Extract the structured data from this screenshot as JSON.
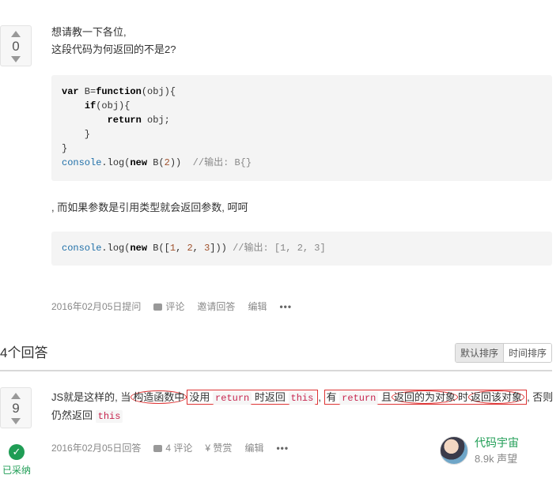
{
  "question": {
    "votes": "0",
    "lines": [
      "想请教一下各位,",
      "这段代码为何返回的不是2?"
    ],
    "code1": [
      {
        "parts": [
          [
            "kw",
            "var"
          ],
          [
            "",
            " B="
          ],
          [
            "kw",
            "function"
          ],
          [
            "",
            "(obj){"
          ]
        ]
      },
      {
        "parts": [
          [
            "",
            "    "
          ],
          [
            "kw",
            "if"
          ],
          [
            "",
            "(obj){"
          ]
        ]
      },
      {
        "parts": [
          [
            "",
            "        "
          ],
          [
            "kw",
            "return"
          ],
          [
            "",
            " obj;"
          ]
        ]
      },
      {
        "parts": [
          [
            "",
            "    }"
          ]
        ]
      },
      {
        "parts": [
          [
            "",
            "}"
          ]
        ]
      },
      {
        "parts": [
          [
            "fn",
            "console"
          ],
          [
            "",
            ".log("
          ],
          [
            "kw",
            "new"
          ],
          [
            "",
            " B("
          ],
          [
            "num",
            "2"
          ],
          [
            "",
            "))  "
          ],
          [
            "cm",
            "//输出: B{}"
          ]
        ]
      }
    ],
    "mid_text": ", 而如果参数是引用类型就会返回参数, 呵呵",
    "code2": [
      {
        "parts": [
          [
            "fn",
            "console"
          ],
          [
            "",
            ".log("
          ],
          [
            "kw",
            "new"
          ],
          [
            "",
            " B(["
          ],
          [
            "num",
            "1"
          ],
          [
            "",
            ", "
          ],
          [
            "num",
            "2"
          ],
          [
            "",
            ", "
          ],
          [
            "num",
            "3"
          ],
          [
            "",
            "])) "
          ],
          [
            "cm",
            "//输出: [1, 2, 3]"
          ]
        ]
      }
    ],
    "meta": {
      "asked": "2016年02月05日提问",
      "comment": "评论",
      "invite": "邀请回答",
      "edit": "编辑",
      "more": "•••"
    }
  },
  "answers": {
    "title": "4个回答",
    "sort_default": "默认排序",
    "sort_time": "时间排序"
  },
  "answer": {
    "votes": "9",
    "t1": "JS就是这样的, 当",
    "t2": "构造函数中",
    "t3": "没用 ",
    "c_return1": "return",
    "t4": " 时返回 ",
    "c_this1": "this",
    "t5": ", ",
    "t6": "有 ",
    "c_return2": "return",
    "t7": " 且",
    "t8": "返回的为对象",
    "t9": "时",
    "t10": "返回该对象",
    "t11": ", 否则仍然返回 ",
    "c_this2": "this",
    "accepted_label": "已采纳",
    "meta": {
      "answered": "2016年02月05日回答",
      "comments": "4 评论",
      "reward": "¥ 赞赏",
      "edit": "编辑",
      "more": "•••"
    },
    "user": {
      "name": "代码宇宙",
      "rep": "8.9k 声望"
    }
  },
  "colors": {
    "accent_green": "#1f9d55",
    "annotation_red": "#dd3333"
  }
}
